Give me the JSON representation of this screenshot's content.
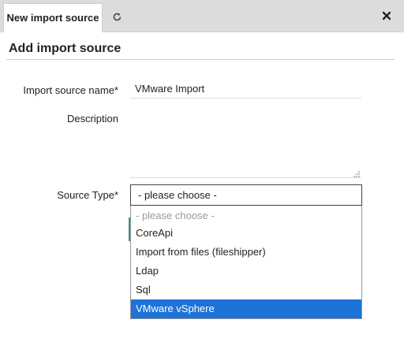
{
  "tabs": {
    "active_label": "New import source",
    "refresh_icon": "refresh-icon",
    "close_icon": "close-icon"
  },
  "page": {
    "title": "Add import source"
  },
  "form": {
    "name_label": "Import source name*",
    "name_value": "VMware Import",
    "description_label": "Description",
    "description_value": "",
    "source_type_label": "Source Type*",
    "source_type_value": "- please choose -"
  },
  "dropdown": {
    "options": [
      "- please choose -",
      "CoreApi",
      "Import from files (fileshipper)",
      "Ldap",
      "Sql",
      "VMware vSphere"
    ],
    "highlighted_index": 5
  },
  "colors": {
    "highlight": "#1e73d8",
    "button_edge": "#3a8e8a"
  }
}
